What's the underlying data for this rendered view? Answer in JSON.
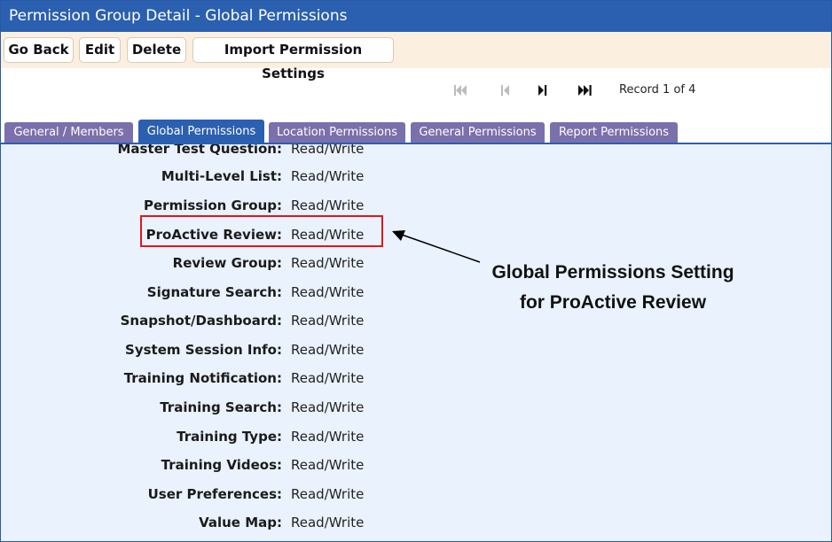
{
  "window": {
    "title": "Permission Group Detail - Global Permissions"
  },
  "toolbar": {
    "go_back": "Go Back",
    "edit": "Edit",
    "delete": "Delete",
    "import": "Import Permission Settings"
  },
  "pager": {
    "record_text": "Record 1 of 4",
    "icons": [
      "first-page-icon",
      "previous-page-icon",
      "next-page-icon",
      "last-page-icon"
    ]
  },
  "tabs": [
    {
      "label": "General / Members",
      "active": false
    },
    {
      "label": "Global Permissions",
      "active": true
    },
    {
      "label": "Location Permissions",
      "active": false
    },
    {
      "label": "General Permissions",
      "active": false
    },
    {
      "label": "Report Permissions",
      "active": false
    }
  ],
  "permissions": [
    {
      "label": "Master Test Question:",
      "value": "Read/Write"
    },
    {
      "label": "Multi-Level List:",
      "value": "Read/Write"
    },
    {
      "label": "Permission Group:",
      "value": "Read/Write"
    },
    {
      "label": "ProActive Review:",
      "value": "Read/Write"
    },
    {
      "label": "Review Group:",
      "value": "Read/Write"
    },
    {
      "label": "Signature Search:",
      "value": "Read/Write"
    },
    {
      "label": "Snapshot/Dashboard:",
      "value": "Read/Write"
    },
    {
      "label": "System Session Info:",
      "value": "Read/Write"
    },
    {
      "label": "Training Notification:",
      "value": "Read/Write"
    },
    {
      "label": "Training Search:",
      "value": "Read/Write"
    },
    {
      "label": "Training Type:",
      "value": "Read/Write"
    },
    {
      "label": "Training Videos:",
      "value": "Read/Write"
    },
    {
      "label": "User Preferences:",
      "value": "Read/Write"
    },
    {
      "label": "Value Map:",
      "value": "Read/Write"
    }
  ],
  "annotation": {
    "line1": "Global Permissions Setting",
    "line2": "for ProActive Review",
    "highlight_color": "#e0161b"
  },
  "colors": {
    "title_bar": "#2b5fb0",
    "tab": "#7b70ab",
    "panel": "#eaf2fd",
    "toolbar": "#fbf0df"
  }
}
